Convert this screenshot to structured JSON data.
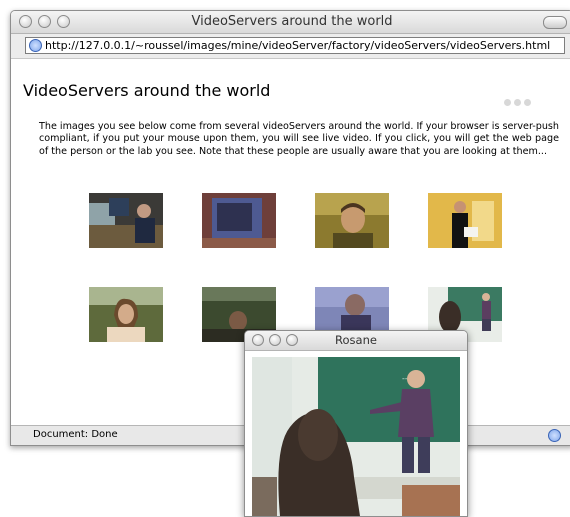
{
  "window": {
    "title": "VideoServers around the world",
    "url": "http://127.0.0.1/~roussel/images/mine/videoServer/factory/videoServers/videoServers.html"
  },
  "page": {
    "heading": "VideoServers around the world",
    "intro": "The images you see below come from several videoServers around the world. If your browser is server-push compliant, if you put your mouse upon them, you will see live video. If you click, you will get the web page of the person or the lab you see. Note that these people are usually aware that you are looking at them..."
  },
  "thumbnails": [
    {
      "id": 1,
      "icon": "office-video-thumbnail"
    },
    {
      "id": 2,
      "icon": "office-video-thumbnail"
    },
    {
      "id": 3,
      "icon": "person-video-thumbnail"
    },
    {
      "id": 4,
      "icon": "person-video-thumbnail"
    },
    {
      "id": 5,
      "icon": "person-video-thumbnail"
    },
    {
      "id": 6,
      "icon": "person-video-thumbnail"
    },
    {
      "id": 7,
      "icon": "person-video-thumbnail"
    },
    {
      "id": 8,
      "icon": "classroom-video-thumbnail"
    }
  ],
  "status": {
    "text": "Document: Done"
  },
  "popup": {
    "title": "Rosane"
  }
}
